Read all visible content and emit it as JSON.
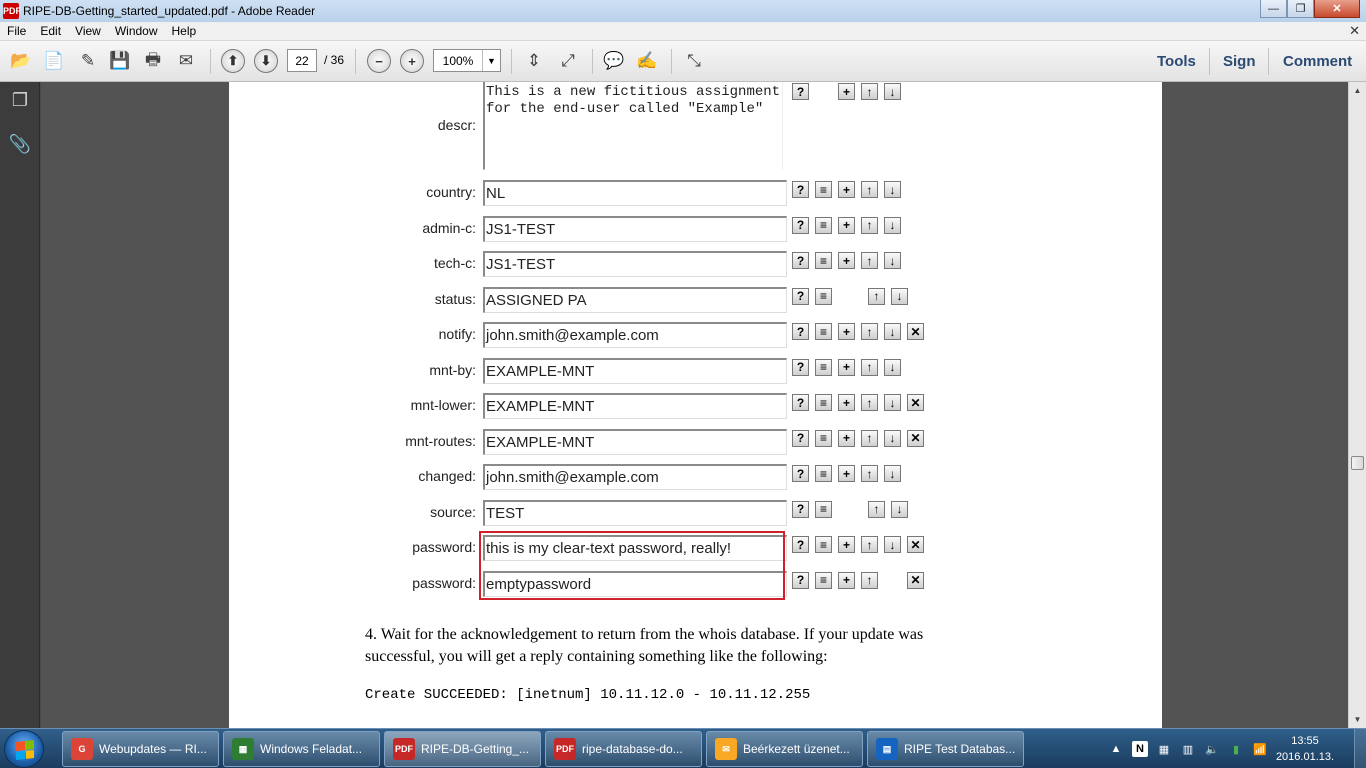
{
  "window": {
    "title": "RIPE-DB-Getting_started_updated.pdf - Adobe Reader",
    "app_icon_label": "PDF",
    "minimize": "—",
    "maximize": "❐",
    "close": "✕"
  },
  "menu": {
    "items": [
      "File",
      "Edit",
      "View",
      "Window",
      "Help"
    ],
    "close_doc": "✕"
  },
  "toolbar": {
    "page_current": "22",
    "page_total": "/ 36",
    "zoom": "100%",
    "zoom_arrow": "▼",
    "tools_label": "Tools",
    "sign_label": "Sign",
    "comment_label": "Comment",
    "icons": {
      "open": "📂",
      "create": "📄",
      "edit": "✎",
      "save": "💾",
      "print": "🖶",
      "email": "✉",
      "prev": "⬆",
      "next": "⬇",
      "zoom_out": "−",
      "zoom_in": "+",
      "fit_page": "⇕",
      "fit_width": "⤢",
      "comment": "💬",
      "highlight": "✍",
      "full_screen": "⤡"
    }
  },
  "navpanel": {
    "pages_icon": "❐",
    "attachments_icon": "📎"
  },
  "form": {
    "descr": {
      "label": "descr:",
      "value": "This is a new fictitious assignment\nfor the end-user called \"Example\""
    },
    "rows": [
      {
        "label": "country:",
        "value": "NL",
        "buttons": [
          "?",
          "≡",
          "+",
          "↑",
          "↓"
        ]
      },
      {
        "label": "admin-c:",
        "value": "JS1-TEST",
        "buttons": [
          "?",
          "≡",
          "+",
          "↑",
          "↓"
        ]
      },
      {
        "label": "tech-c:",
        "value": "JS1-TEST",
        "buttons": [
          "?",
          "≡",
          "+",
          "↑",
          "↓"
        ]
      },
      {
        "label": "status:",
        "value": "ASSIGNED PA",
        "buttons": [
          "?",
          "≡",
          "",
          "↑",
          "↓"
        ]
      },
      {
        "label": "notify:",
        "value": "john.smith@example.com",
        "buttons": [
          "?",
          "≡",
          "+",
          "↑",
          "↓",
          "✕"
        ]
      },
      {
        "label": "mnt-by:",
        "value": "EXAMPLE-MNT",
        "buttons": [
          "?",
          "≡",
          "+",
          "↑",
          "↓"
        ]
      },
      {
        "label": "mnt-lower:",
        "value": "EXAMPLE-MNT",
        "buttons": [
          "?",
          "≡",
          "+",
          "↑",
          "↓",
          "✕"
        ]
      },
      {
        "label": "mnt-routes:",
        "value": "EXAMPLE-MNT",
        "buttons": [
          "?",
          "≡",
          "+",
          "↑",
          "↓",
          "✕"
        ]
      },
      {
        "label": "changed:",
        "value": "john.smith@example.com",
        "buttons": [
          "?",
          "≡",
          "+",
          "↑",
          "↓"
        ]
      },
      {
        "label": "source:",
        "value": "TEST",
        "buttons": [
          "?",
          "≡",
          "",
          "↑",
          "↓"
        ]
      },
      {
        "label": "password:",
        "value": "this is my clear-text password, really!",
        "buttons": [
          "?",
          "≡",
          "+",
          "↑",
          "↓",
          "✕"
        ]
      },
      {
        "label": "password:",
        "value": "emptypassword",
        "buttons": [
          "?",
          "≡",
          "+",
          "↑",
          "",
          "✕"
        ]
      }
    ],
    "descr_buttons": [
      "?",
      "",
      "+",
      "↑",
      "↓"
    ]
  },
  "body_text": {
    "step4_line1": "4. Wait for the acknowledgement to return from the whois database. If your update was",
    "step4_line2": "successful, you will get a reply containing something like the following:",
    "result": "Create SUCCEEDED: [inetnum] 10.11.12.0 - 10.11.12.255"
  },
  "scrollbar": {
    "up": "▲",
    "down": "▼"
  },
  "taskbar": {
    "tasks": [
      {
        "label": "Webupdates — RI...",
        "icon_color": "#db4437",
        "icon_text": "G"
      },
      {
        "label": "Windows Feladat...",
        "icon_color": "#2e7d32",
        "icon_text": "▦"
      },
      {
        "label": "RIPE-DB-Getting_...",
        "icon_color": "#c62828",
        "icon_text": "PDF"
      },
      {
        "label": "ripe-database-do...",
        "icon_color": "#c62828",
        "icon_text": "PDF"
      },
      {
        "label": "Beérkezett üzenet...",
        "icon_color": "#f9a825",
        "icon_text": "✉"
      },
      {
        "label": "RIPE Test Databas...",
        "icon_color": "#1565c0",
        "icon_text": "▤"
      }
    ],
    "tray": [
      "▲",
      "N",
      "▦",
      "▥",
      "🔈",
      "▮",
      "📶"
    ],
    "time": "13:55",
    "date": "2016.01.13."
  },
  "colors": {
    "highlight_border": "#d0202a",
    "toolbar_link": "#2b4a73",
    "doc_bg": "#535353"
  }
}
